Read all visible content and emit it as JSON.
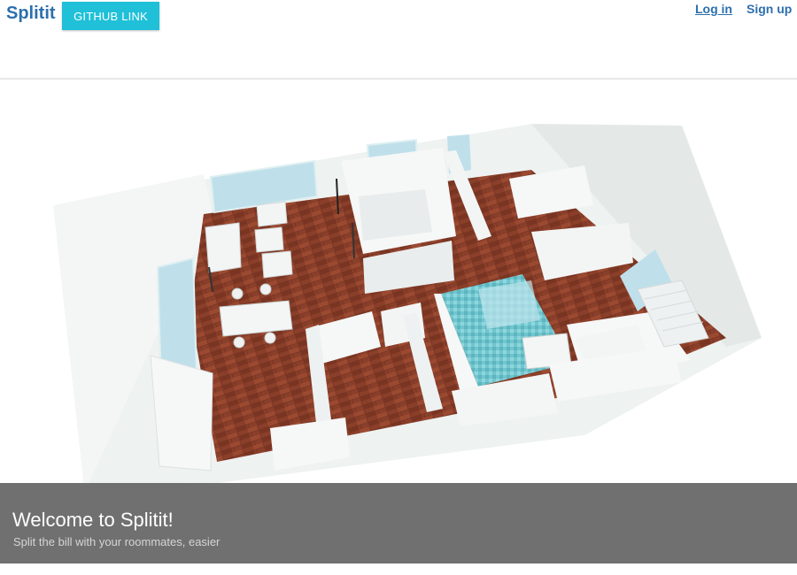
{
  "navbar": {
    "brand": "Splitit",
    "github_label": "GITHUB LINK",
    "login_label": "Log in",
    "signup_label": "Sign up"
  },
  "hero": {
    "image_alt": "apartment-floor-plan-illustration",
    "title": "Welcome to Splitit!",
    "subtitle": "Split the bill with your roommates, easier"
  },
  "colors": {
    "brand": "#2d6fad",
    "github_button": "#1fc0d8",
    "caption_overlay": "#646464",
    "floor_wood": "#8a3f2a",
    "walls": "#f2f4f3",
    "pool_tile": "#6fc6cf"
  }
}
